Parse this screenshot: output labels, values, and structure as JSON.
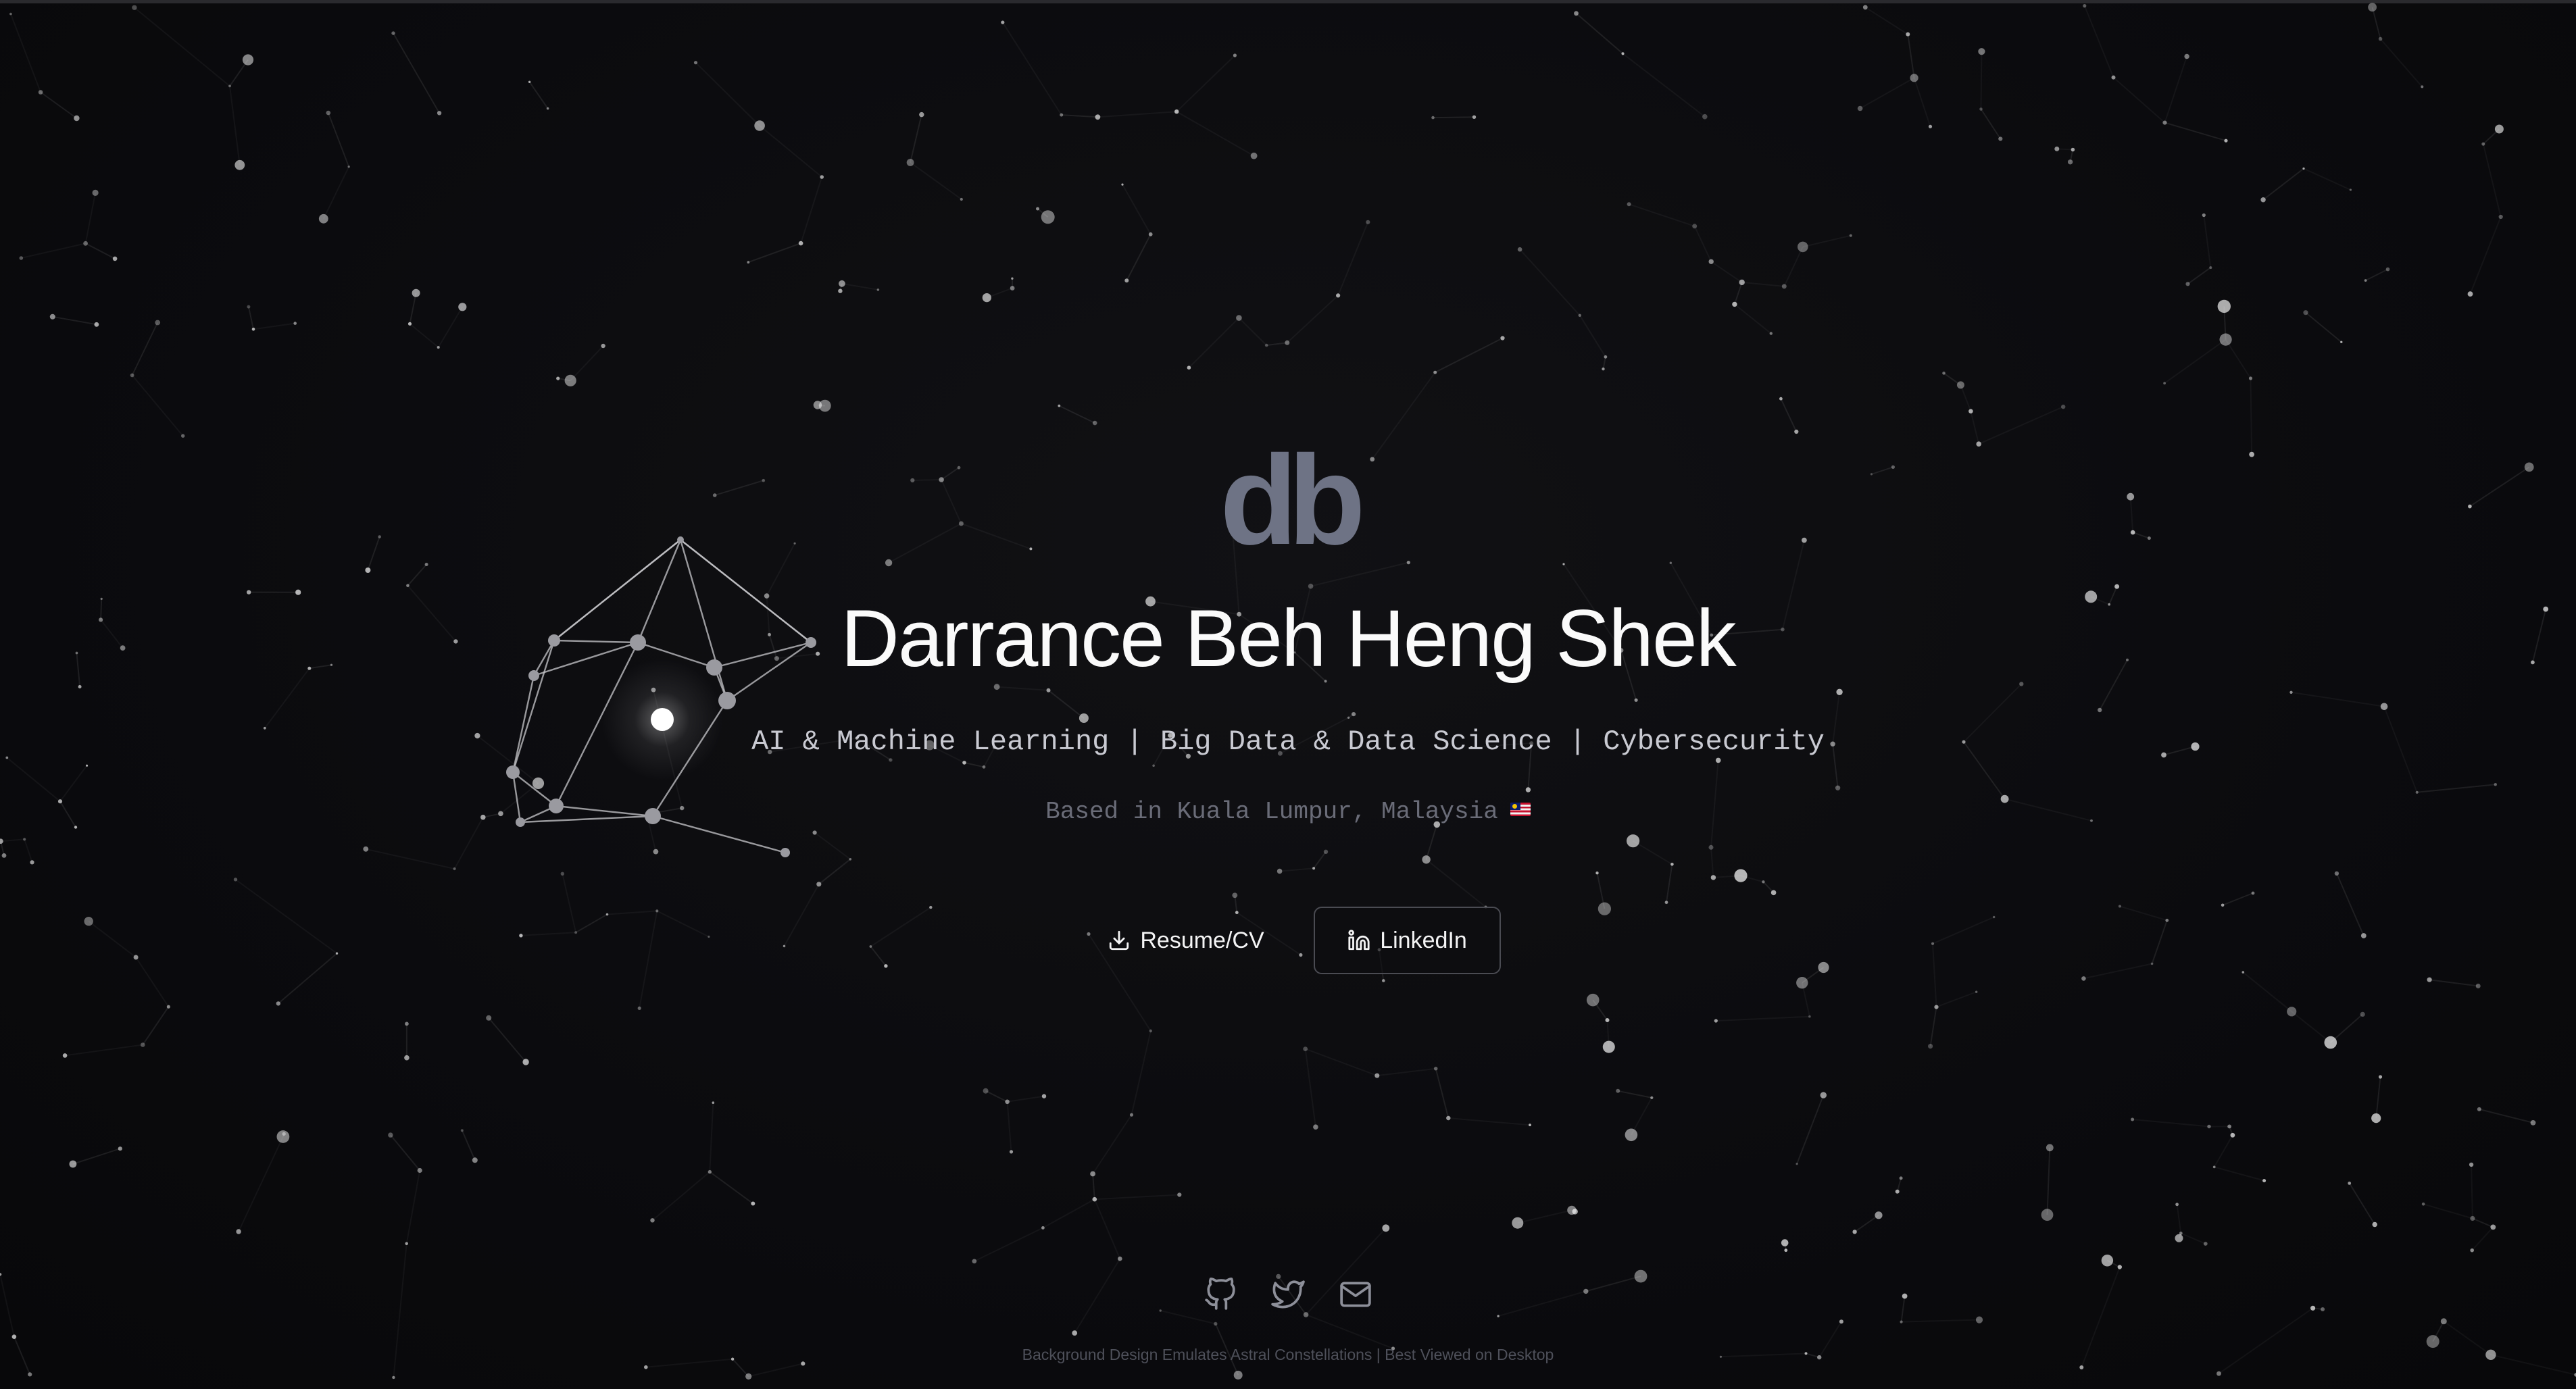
{
  "logo": {
    "text": "db"
  },
  "hero": {
    "name": "Darrance Beh Heng Shek",
    "tagline": "AI & Machine Learning | Big Data & Data Science | Cybersecurity",
    "location": "Based in Kuala Lumpur, Malaysia",
    "location_flag": "Malaysia flag"
  },
  "buttons": {
    "resume_label": "Resume/CV",
    "resume_icon": "download-icon",
    "linkedin_label": "LinkedIn",
    "linkedin_icon": "linkedin-icon"
  },
  "socials": [
    {
      "icon": "github-icon"
    },
    {
      "icon": "twitter-icon"
    },
    {
      "icon": "mail-icon"
    }
  ],
  "footer": {
    "text": "Background Design Emulates Astral Constellations | Best Viewed on Desktop"
  },
  "colors": {
    "background": "#0c0c0f",
    "logo": "#6e7385",
    "heading": "#fafafa",
    "tagline": "#c9cad2",
    "muted": "#6a6c78",
    "button_border": "#4a4b52",
    "constellation": "#bfbfc4"
  }
}
